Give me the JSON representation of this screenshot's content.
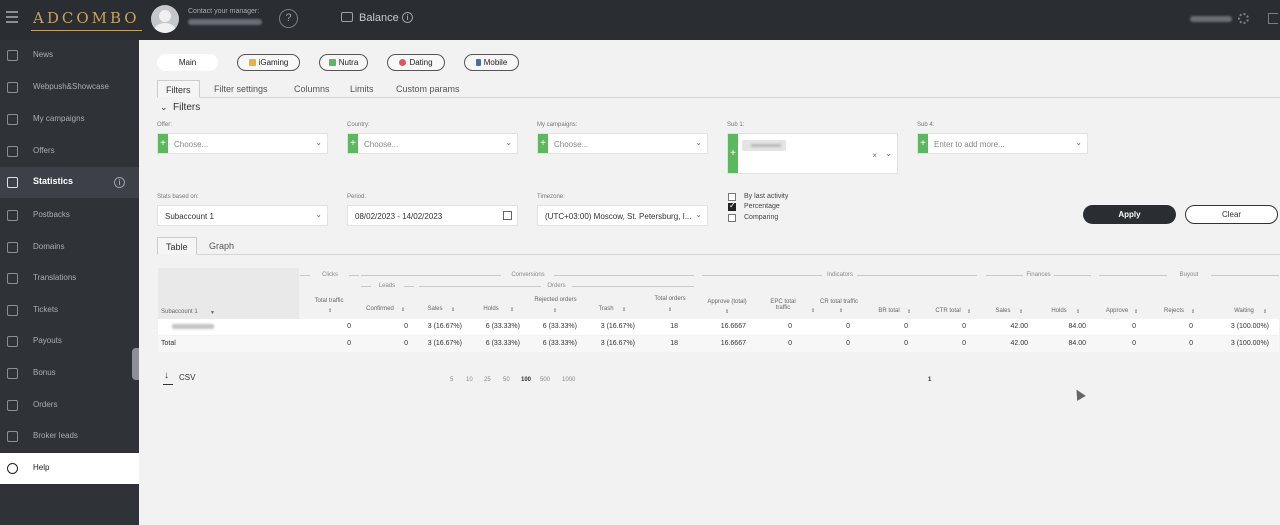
{
  "topbar": {
    "logo": "ADCOMBO",
    "contact_label": "Contact your manager:",
    "help_glyph": "?",
    "balance_label": "Balance",
    "info_glyph": "i"
  },
  "sidebar": {
    "items": [
      {
        "label": "News",
        "icon": "news-icon"
      },
      {
        "label": "Webpush&Showcase",
        "icon": "webpush-icon"
      },
      {
        "label": "My campaigns",
        "icon": "shuffle-icon"
      },
      {
        "label": "Offers",
        "icon": "offers-icon"
      },
      {
        "label": "Statistics",
        "icon": "chart-icon",
        "active": true
      },
      {
        "label": "Postbacks",
        "icon": "postback-icon"
      },
      {
        "label": "Domains",
        "icon": "globe-icon"
      },
      {
        "label": "Translations",
        "icon": "translations-icon"
      },
      {
        "label": "Tickets",
        "icon": "bell-icon"
      },
      {
        "label": "Payouts",
        "icon": "wallet-icon"
      },
      {
        "label": "Bonus",
        "icon": "gift-icon"
      },
      {
        "label": "Orders",
        "icon": "calendar-icon"
      },
      {
        "label": "Broker leads",
        "icon": "trend-icon"
      },
      {
        "label": "Help",
        "icon": "info-icon"
      }
    ]
  },
  "vertical_tabs": [
    "Main",
    "iGaming",
    "Nutra",
    "Dating",
    "Mobile"
  ],
  "sub_tabs": [
    "Filters",
    "Filter settings",
    "Columns",
    "Limits",
    "Custom params"
  ],
  "filters_title": "Filters",
  "filters": {
    "offer": {
      "label": "Offer:",
      "placeholder": "Choose..."
    },
    "country": {
      "label": "Country:",
      "placeholder": "Choose..."
    },
    "campaigns": {
      "label": "My campaigns:",
      "placeholder": "Choose..."
    },
    "sub1": {
      "label": "Sub 1:"
    },
    "sub4": {
      "label": "Sub 4:",
      "placeholder": "Enter to add more..."
    },
    "stats_based_on": {
      "label": "Stats based on:",
      "value": "Subaccount 1"
    },
    "period": {
      "label": "Period:",
      "value": "08/02/2023 - 14/02/2023"
    },
    "timezone": {
      "label": "Timezone:",
      "value": "(UTC+03:00) Moscow, St. Petersburg, I..."
    },
    "options": [
      {
        "label": "By last activity",
        "checked": false
      },
      {
        "label": "Percentage",
        "checked": true
      },
      {
        "label": "Comparing",
        "checked": false
      }
    ],
    "apply": "Apply",
    "clear": "Clear"
  },
  "view_tabs": [
    "Table",
    "Graph"
  ],
  "table": {
    "groups": {
      "clicks": "Clicks",
      "conversions": "Conversions",
      "leads": "Leads",
      "orders": "Orders",
      "indicators": "Indicators",
      "finances": "Finances",
      "buyout": "Buyout"
    },
    "columns": [
      "Subaccount 1",
      "Total traffic",
      "Confirmed",
      "Sales",
      "Holds",
      "Rejected orders",
      "Trash",
      "Total orders",
      "Approve (total)",
      "EPC total traffic",
      "CR total traffic",
      "BR total",
      "CTR total",
      "Sales",
      "Holds",
      "Approve",
      "Rejects",
      "Waiting"
    ],
    "rows": [
      {
        "cells": [
          "",
          "0",
          "0",
          "3 (16.67%)",
          "6 (33.33%)",
          "6 (33.33%)",
          "3 (16.67%)",
          "18",
          "16.6667",
          "0",
          "0",
          "0",
          "0",
          "42.00",
          "84.00",
          "0",
          "0",
          "3 (100.00%)"
        ]
      },
      {
        "cells": [
          "Total",
          "0",
          "0",
          "3 (16.67%)",
          "6 (33.33%)",
          "6 (33.33%)",
          "3 (16.67%)",
          "18",
          "16.6667",
          "0",
          "0",
          "0",
          "0",
          "42.00",
          "84.00",
          "0",
          "0",
          "3 (100.00%)"
        ]
      }
    ]
  },
  "footer": {
    "csv": "CSV",
    "page_sizes": [
      "5",
      "10",
      "25",
      "50",
      "100",
      "500",
      "1000"
    ],
    "selected_page_size": "100",
    "page": "1"
  }
}
